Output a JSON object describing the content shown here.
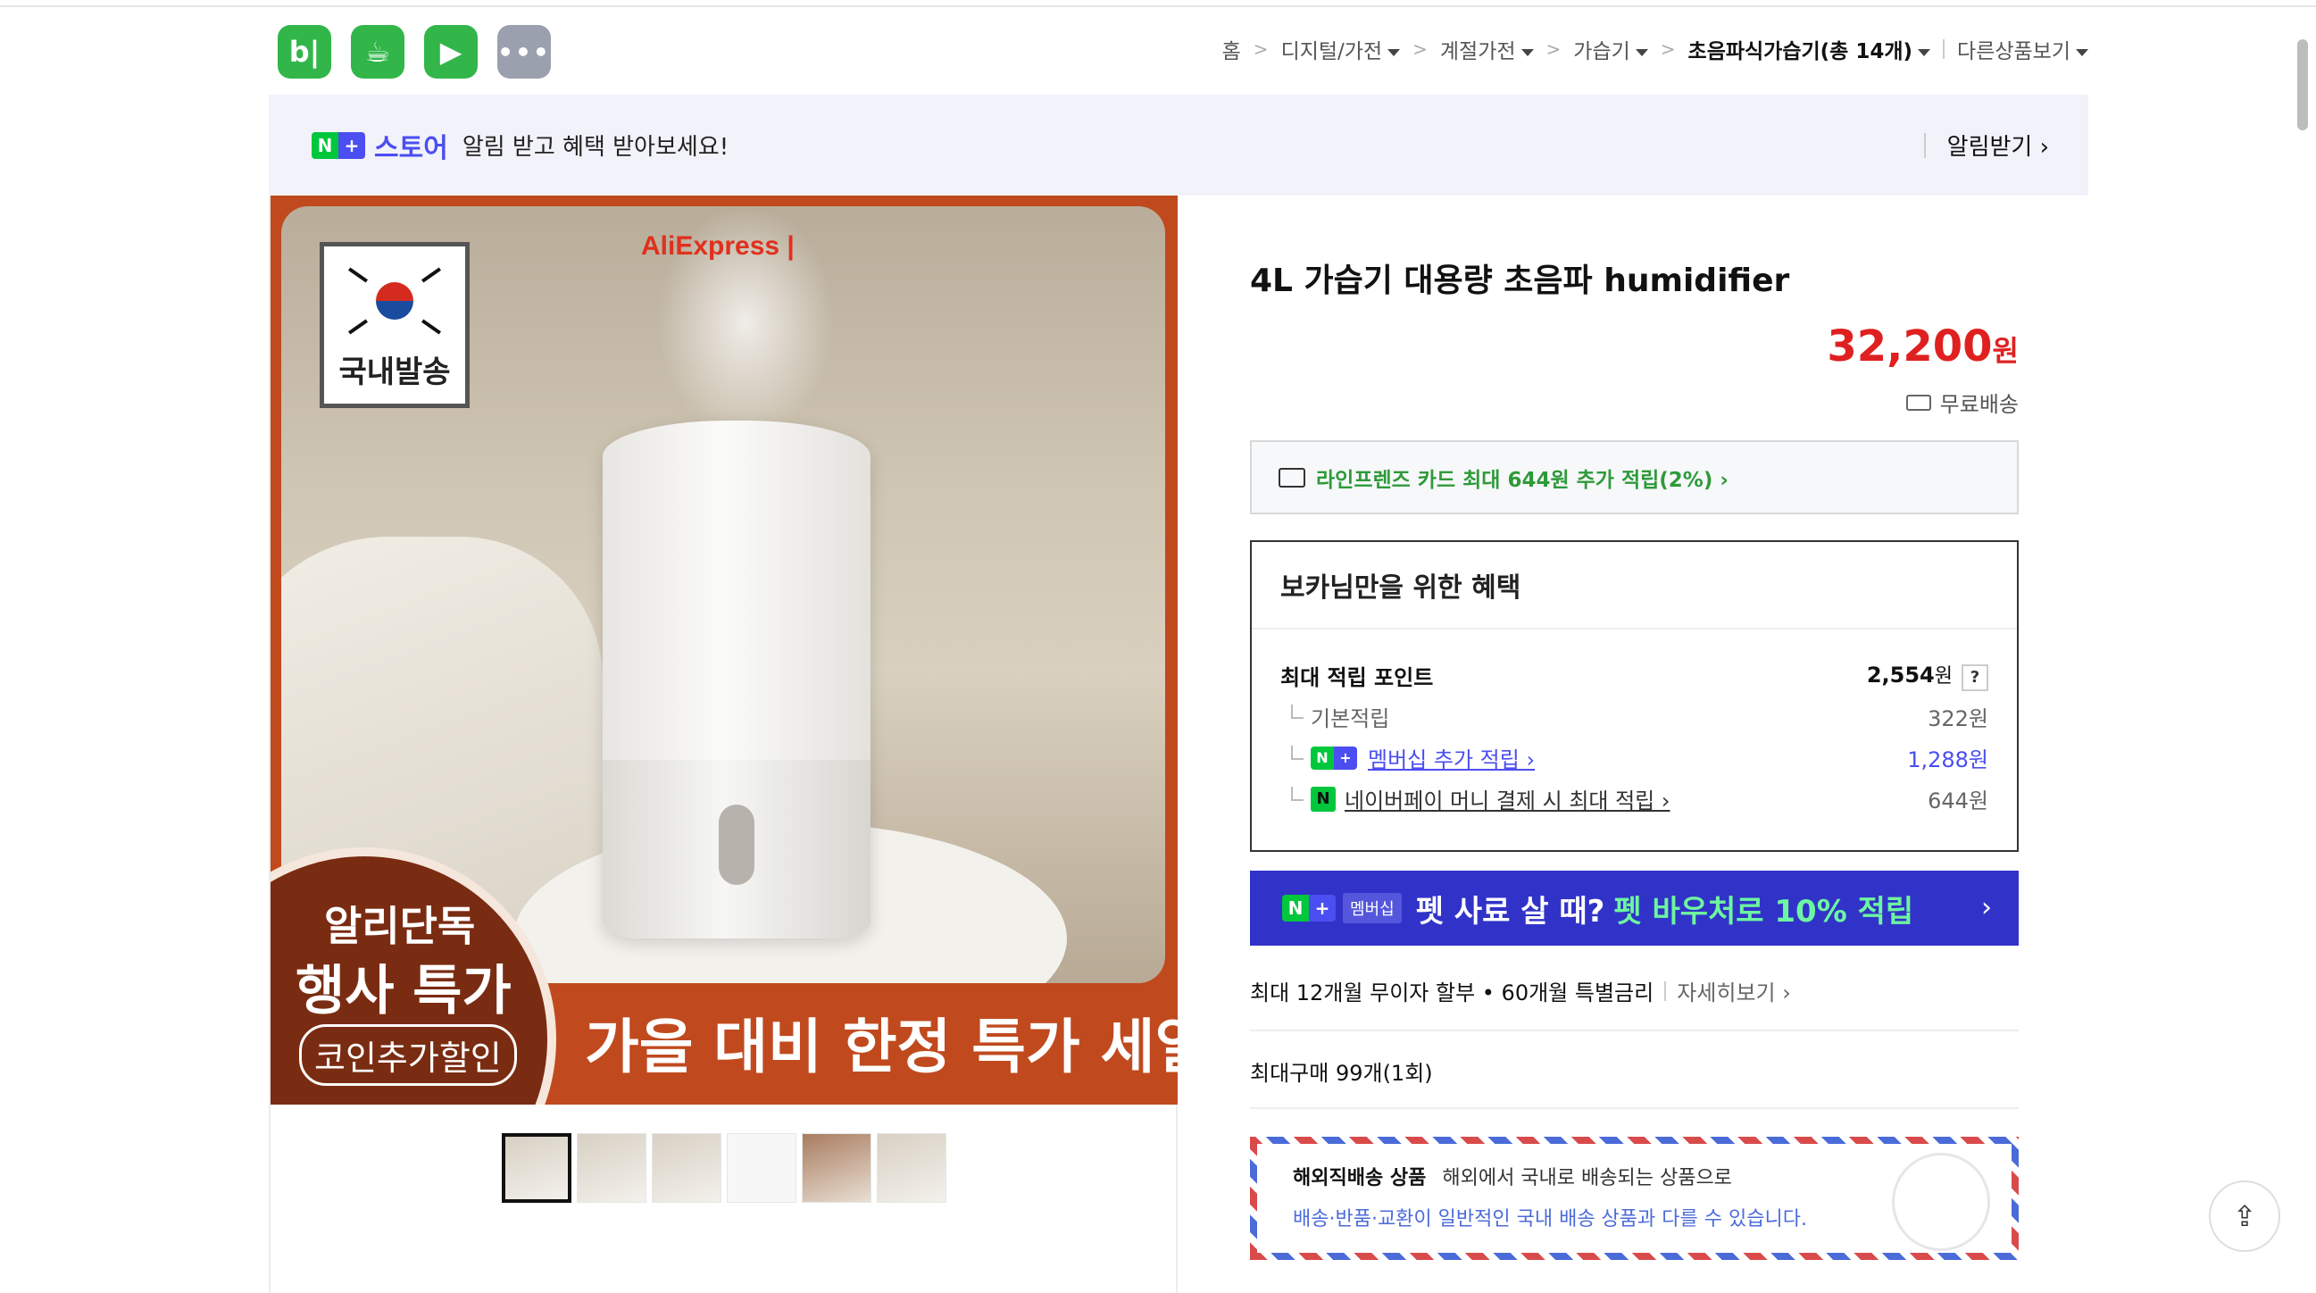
{
  "apps": [
    {
      "icon": "blog-icon",
      "glyph": "b|"
    },
    {
      "icon": "cafe-icon",
      "glyph": "☕"
    },
    {
      "icon": "bookmark-icon",
      "glyph": "▶"
    },
    {
      "icon": "more-icon",
      "glyph": "•••"
    }
  ],
  "breadcrumb": {
    "home": "홈",
    "items": [
      "디지털/가전",
      "계절가전",
      "가습기"
    ],
    "current": "초음파식가습기(총 14개)",
    "other": "다른상품보기"
  },
  "banner": {
    "badge_n": "N",
    "badge_plus": "+",
    "store": "스토어",
    "message": "알림 받고 혜택 받아보세요!",
    "action": "알림받기 ›"
  },
  "image": {
    "brand_watermark": "AliExpress |",
    "domestic": "국내발송",
    "promo_line1": "알리단독",
    "promo_line2": "행사 특가",
    "promo_line3": "코인추가할인",
    "promo_main": "가을 대비 한정 특가 세일"
  },
  "product": {
    "title": "4L 가습기 대용량 초음파 humidifier",
    "price": "32,200",
    "currency": "원",
    "shipping": "무료배송"
  },
  "card_offer": "라인프렌즈 카드 최대 644원 추가 적립(2%) ›",
  "benefit": {
    "heading": "보카님만을 위한 혜택",
    "max_points_label": "최대 적립 포인트",
    "max_points_value": "2,554",
    "max_points_unit": "원",
    "help": "?",
    "rows": [
      {
        "label": "기본적립",
        "value": "322원"
      },
      {
        "label": "멤버십 추가 적립 ›",
        "value": "1,288원"
      },
      {
        "label": "네이버페이 머니 결제 시 최대 적립 ›",
        "value": "644원"
      }
    ]
  },
  "membership_banner": {
    "tag": "멤버십",
    "text1": "펫 사료 살 때?",
    "text2": "펫 바우처로 10% 적립",
    "arrow": "›"
  },
  "installment": {
    "text": "최대 12개월 무이자 할부 • 60개월 특별금리",
    "detail": "자세히보기 ›"
  },
  "max_purchase": "최대구매 99개(1회)",
  "overseas": {
    "title": "해외직배송 상품",
    "line1": "해외에서 국내로 배송되는 상품으로",
    "line2": "배송·반품·교환이 일반적인 국내 배송 상품과 다를 수 있습니다."
  },
  "colors": {
    "price": "#e02020",
    "naver_green": "#00c73c",
    "membership_purple": "#4b4ef0"
  }
}
